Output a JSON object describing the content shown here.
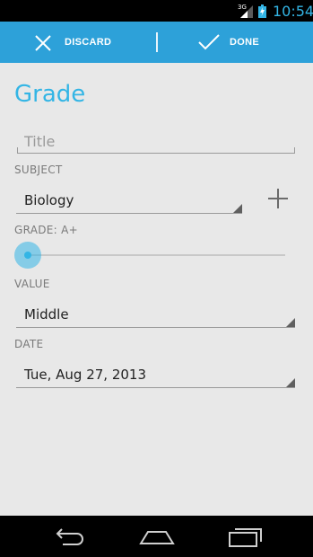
{
  "status_bar": {
    "network_type": "3G",
    "time": "10:54",
    "icons": [
      "signal-icon",
      "battery-charging-icon"
    ]
  },
  "action_bar": {
    "discard_label": "DISCARD",
    "done_label": "DONE",
    "icons": [
      "close-icon",
      "check-icon"
    ],
    "background_color": "#2da1d9"
  },
  "page": {
    "title": "Grade",
    "accent_color": "#33b5e5"
  },
  "form": {
    "title_field": {
      "placeholder": "Title",
      "value": ""
    },
    "subject": {
      "label": "SUBJECT",
      "selected": "Biology",
      "add_icon": "plus-icon"
    },
    "grade": {
      "label": "GRADE: A+",
      "slider_fraction": 0.0
    },
    "value": {
      "label": "VALUE",
      "selected": "Middle"
    },
    "date": {
      "label": "DATE",
      "selected": "Tue, Aug 27, 2013"
    }
  },
  "nav_bar": {
    "buttons": [
      "back-icon",
      "home-icon",
      "recent-apps-icon"
    ]
  }
}
